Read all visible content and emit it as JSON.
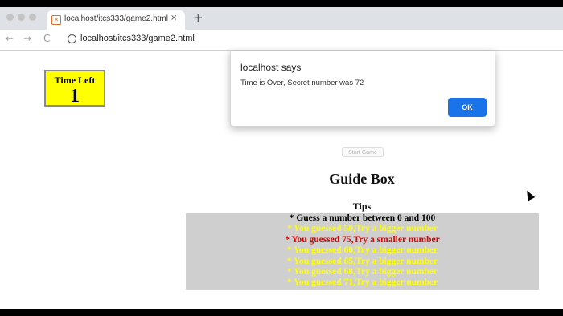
{
  "browser": {
    "tab_title": "localhost/itcs333/game2.html",
    "tab_close_glyph": "×",
    "new_tab_glyph": "+",
    "back_glyph": "←",
    "forward_glyph": "→",
    "reload_glyph": "C",
    "info_glyph": "i",
    "url": "localhost/itcs333/game2.html"
  },
  "timer": {
    "label": "Time Left",
    "value": "1"
  },
  "start_button": {
    "label": "Start Game"
  },
  "guide": {
    "title": "Guide Box",
    "tips_heading": "Tips",
    "tips": [
      {
        "text": "* Guess a number between 0 and 100",
        "color": "#000000"
      },
      {
        "text": "* You guessed 50,Try a bigger number",
        "color": "#ffff00"
      },
      {
        "text": "* You guessed 75,Try a smaller number",
        "color": "#e00000"
      },
      {
        "text": "* You guessed 60,Try a bigger number",
        "color": "#ffff00"
      },
      {
        "text": "* You guessed 65,Try a bigger number",
        "color": "#ffff00"
      },
      {
        "text": "* You guessed 68,Try a bigger number",
        "color": "#ffff00"
      },
      {
        "text": "* You guessed 71,Try a bigger number",
        "color": "#ffff00"
      }
    ]
  },
  "dialog": {
    "title": "localhost says",
    "message": "Time is Over, Secret number was 72",
    "ok_label": "OK"
  },
  "colors": {
    "timer_bg": "#ffff00",
    "guide_panel_bg": "#cfcfcf",
    "ok_button": "#1a73e8"
  }
}
